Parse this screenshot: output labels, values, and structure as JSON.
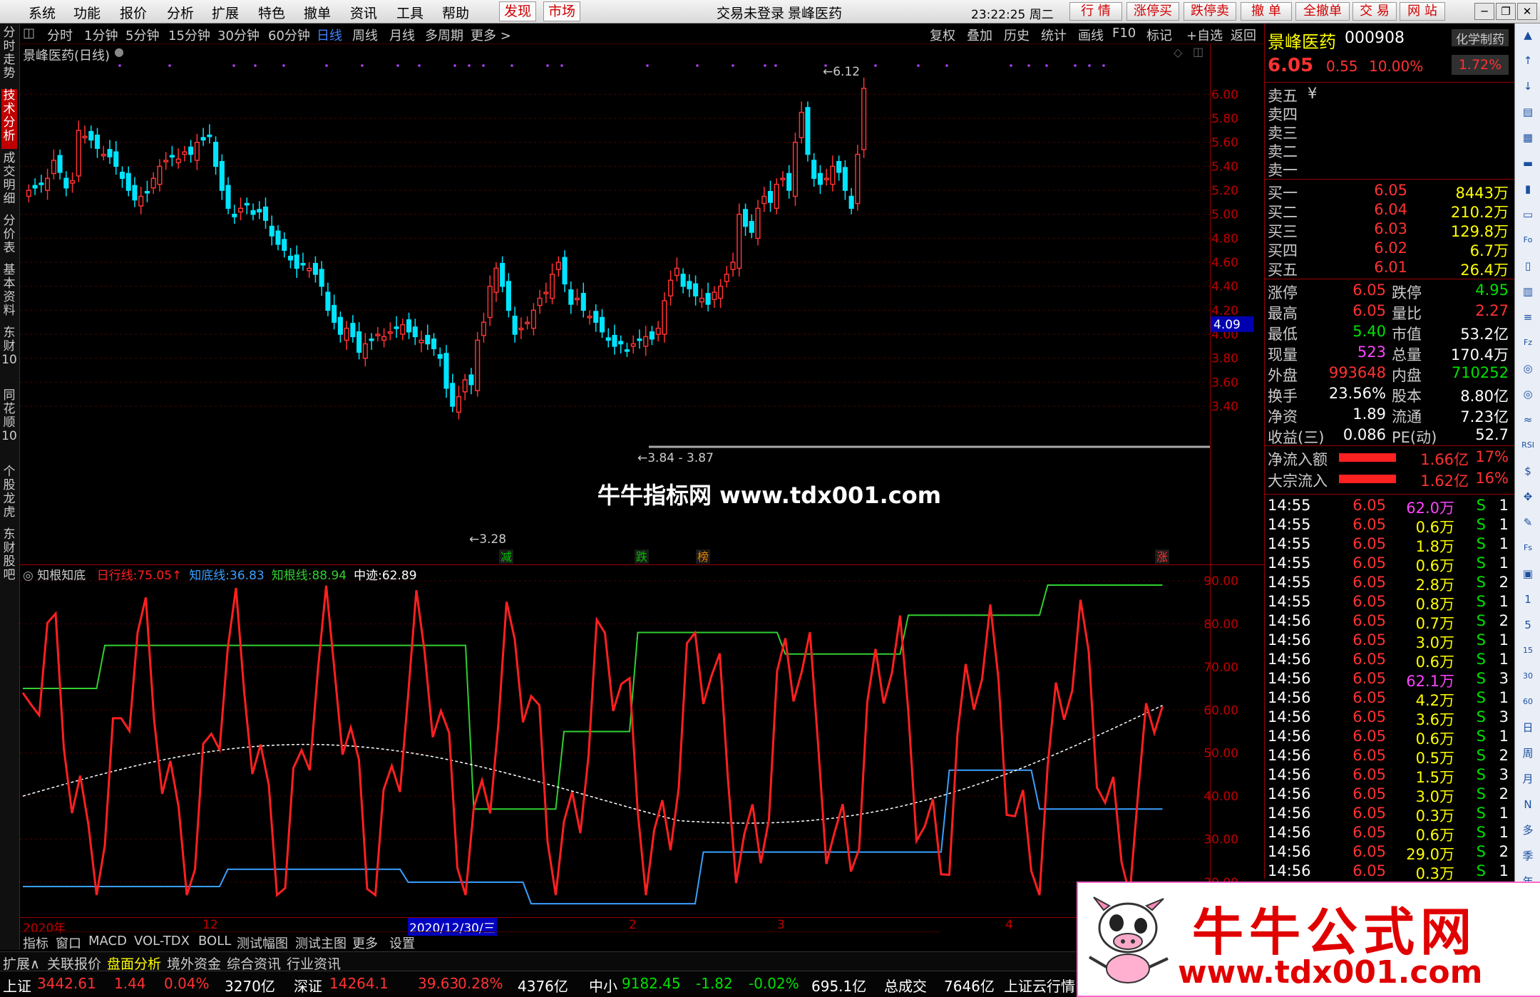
{
  "menu": {
    "items": [
      "系统",
      "功能",
      "报价",
      "分析",
      "扩展",
      "特色",
      "撤单",
      "资讯",
      "工具",
      "帮助"
    ],
    "hot": [
      "发现",
      "市场"
    ],
    "login_status": "交易未登录",
    "stock_title": "景峰医药",
    "clock": "23:22:25 周二",
    "trade_buttons": [
      "行 情",
      "涨停买",
      "跌停卖",
      "撤 单",
      "全撤单",
      "交 易",
      "网 站"
    ],
    "window_buttons": [
      "─",
      "❐",
      "✕"
    ]
  },
  "periods": [
    "分时",
    "1分钟",
    "5分钟",
    "15分钟",
    "30分钟",
    "60分钟",
    "日线",
    "周线",
    "月线",
    "多周期",
    "更多 >"
  ],
  "active_period": "日线",
  "tools": [
    "复权",
    "叠加",
    "历史",
    "统计",
    "画线",
    "F10",
    "标记",
    "+自选",
    "返回"
  ],
  "left_tabs": [
    "分时走势",
    "技术分析",
    "成交明细",
    "分价表",
    "基本资料",
    "东财10",
    "同花顺10",
    "个股龙虎",
    "东财股吧"
  ],
  "main_chart": {
    "label": "景峰医药(日线)",
    "price_ticks": [
      "6.00",
      "5.80",
      "5.60",
      "5.40",
      "5.20",
      "5.00",
      "4.80",
      "4.60",
      "4.40",
      "4.20",
      "4.00",
      "3.80",
      "3.60",
      "3.40"
    ],
    "current_price_tag": "4.09",
    "high_marker": "6.12",
    "low_marker": "3.28",
    "range_marker": "3.84 - 3.87",
    "event_labels": [
      {
        "text": "减",
        "color": "#00c000"
      },
      {
        "text": "跌",
        "color": "#00c000"
      },
      {
        "text": "榜",
        "color": "#e08000"
      },
      {
        "text": "涨",
        "color": "#ff3030"
      }
    ],
    "watermark": "牛牛指标网 www.tdx001.com"
  },
  "indicator": {
    "name": "知根知底",
    "lines": [
      {
        "label": "日行线:",
        "value": "75.05↑",
        "color": "#ff2020"
      },
      {
        "label": "知底线:",
        "value": "36.83",
        "color": "#3aa0ff"
      },
      {
        "label": "知根线:",
        "value": "88.94",
        "color": "#30d030"
      },
      {
        "label": "中迹:",
        "value": "62.89",
        "color": "#ffffff"
      }
    ],
    "ticks": [
      "90.00",
      "80.00",
      "70.00",
      "60.00",
      "50.00",
      "40.00",
      "30.00",
      "20.00"
    ]
  },
  "time_axis": {
    "labels": [
      "2020年",
      "12",
      "2020/12/30/三",
      "2",
      "3",
      "4"
    ]
  },
  "bottom_tabs": [
    "指标",
    "窗口",
    "MACD",
    "VOL-TDX",
    "BOLL",
    "测试幅图",
    "测试主图",
    "更多",
    "设置"
  ],
  "ext_tabs": [
    "扩展∧",
    "关联报价",
    "盘面分析",
    "境外资金",
    "综合资讯",
    "行业资讯"
  ],
  "status_bar": {
    "sh_label": "上证",
    "sh_index": "3442.61",
    "sh_change": "1.44",
    "sh_pct": "0.04%",
    "sh_amount": "3270亿",
    "sz_label": "深证",
    "sz_index": "14264.1",
    "sz_change": "39.63",
    "sz_pct": "0.28%",
    "sz_amount": "4376亿",
    "zx_label": "中小",
    "zx_index": "9182.45",
    "zx_change": "-1.82",
    "zx_pct": "-0.02%",
    "zx_amount": "695.1亿",
    "total_label": "总成交",
    "total_amount": "7646亿",
    "cloud": "上证云行情"
  },
  "quote": {
    "name": "景峰医药",
    "code": "000908",
    "industry": "化学制药",
    "price": "6.05",
    "change": "0.55",
    "pct": "10.00%",
    "sector_pct": "1.72%",
    "sell": [
      {
        "label": "卖五",
        "extra": "¥"
      },
      {
        "label": "卖四",
        "extra": ""
      },
      {
        "label": "卖三",
        "extra": ""
      },
      {
        "label": "卖二",
        "extra": ""
      },
      {
        "label": "卖一",
        "extra": ""
      }
    ],
    "buy": [
      {
        "label": "买一",
        "price": "6.05",
        "vol": "8443万"
      },
      {
        "label": "买二",
        "price": "6.04",
        "vol": "210.2万"
      },
      {
        "label": "买三",
        "price": "6.03",
        "vol": "129.8万"
      },
      {
        "label": "买四",
        "price": "6.02",
        "vol": "6.7万"
      },
      {
        "label": "买五",
        "price": "6.01",
        "vol": "26.4万"
      }
    ],
    "stats": [
      {
        "l1": "涨停",
        "v1": "6.05",
        "c1": "red",
        "l2": "跌停",
        "v2": "4.95",
        "c2": "green"
      },
      {
        "l1": "最高",
        "v1": "6.05",
        "c1": "red",
        "l2": "量比",
        "v2": "2.27",
        "c2": "red"
      },
      {
        "l1": "最低",
        "v1": "5.40",
        "c1": "green",
        "l2": "市值",
        "v2": "53.2亿",
        "c2": "white"
      },
      {
        "l1": "现量",
        "v1": "523",
        "c1": "magenta",
        "l2": "总量",
        "v2": "170.4万",
        "c2": "white"
      },
      {
        "l1": "外盘",
        "v1": "993648",
        "c1": "red",
        "l2": "内盘",
        "v2": "710252",
        "c2": "green"
      },
      {
        "l1": "换手",
        "v1": "23.56%",
        "c1": "white",
        "l2": "股本",
        "v2": "8.80亿",
        "c2": "white"
      },
      {
        "l1": "净资",
        "v1": "1.89",
        "c1": "white",
        "l2": "流通",
        "v2": "7.23亿",
        "c2": "white"
      },
      {
        "l1": "收益(三)",
        "v1": "0.086",
        "c1": "white",
        "l2": "PE(动)",
        "v2": "52.7",
        "c2": "white"
      }
    ],
    "flows": [
      {
        "label": "净流入额",
        "value": "1.66亿",
        "pct": "17%"
      },
      {
        "label": "大宗流入",
        "value": "1.62亿",
        "pct": "16%"
      }
    ],
    "ticks": [
      {
        "t": "14:55",
        "p": "6.05",
        "v": "62.0万",
        "mag": true,
        "n": "1"
      },
      {
        "t": "14:55",
        "p": "6.05",
        "v": "0.6万",
        "mag": false,
        "n": "1"
      },
      {
        "t": "14:55",
        "p": "6.05",
        "v": "1.8万",
        "mag": false,
        "n": "1"
      },
      {
        "t": "14:55",
        "p": "6.05",
        "v": "0.6万",
        "mag": false,
        "n": "1"
      },
      {
        "t": "14:55",
        "p": "6.05",
        "v": "2.8万",
        "mag": false,
        "n": "2"
      },
      {
        "t": "14:55",
        "p": "6.05",
        "v": "0.8万",
        "mag": false,
        "n": "1"
      },
      {
        "t": "14:56",
        "p": "6.05",
        "v": "0.7万",
        "mag": false,
        "n": "2"
      },
      {
        "t": "14:56",
        "p": "6.05",
        "v": "3.0万",
        "mag": false,
        "n": "1"
      },
      {
        "t": "14:56",
        "p": "6.05",
        "v": "0.6万",
        "mag": false,
        "n": "1"
      },
      {
        "t": "14:56",
        "p": "6.05",
        "v": "62.1万",
        "mag": true,
        "n": "3"
      },
      {
        "t": "14:56",
        "p": "6.05",
        "v": "4.2万",
        "mag": false,
        "n": "1"
      },
      {
        "t": "14:56",
        "p": "6.05",
        "v": "3.6万",
        "mag": false,
        "n": "3"
      },
      {
        "t": "14:56",
        "p": "6.05",
        "v": "0.6万",
        "mag": false,
        "n": "1"
      },
      {
        "t": "14:56",
        "p": "6.05",
        "v": "0.5万",
        "mag": false,
        "n": "2"
      },
      {
        "t": "14:56",
        "p": "6.05",
        "v": "1.5万",
        "mag": false,
        "n": "3"
      },
      {
        "t": "14:56",
        "p": "6.05",
        "v": "3.0万",
        "mag": false,
        "n": "2"
      },
      {
        "t": "14:56",
        "p": "6.05",
        "v": "0.3万",
        "mag": false,
        "n": "1"
      },
      {
        "t": "14:56",
        "p": "6.05",
        "v": "0.6万",
        "mag": false,
        "n": "1"
      },
      {
        "t": "14:56",
        "p": "6.05",
        "v": "29.0万",
        "mag": false,
        "n": "2"
      },
      {
        "t": "14:56",
        "p": "6.05",
        "v": "0.3万",
        "mag": false,
        "n": "1"
      }
    ],
    "side": "S"
  },
  "right_strip": [
    "▲",
    "↑",
    "↓",
    "▤",
    "▦",
    "▬",
    "▮",
    "▭",
    "Fo",
    "▯",
    "▥",
    "≡",
    "Fz",
    "◎",
    "◎",
    "≈",
    "RSI",
    "$",
    "✥",
    "✎",
    "Fs",
    "▣",
    "1",
    "5",
    "15",
    "30",
    "60",
    "日",
    "周",
    "月",
    "N",
    "多",
    "季",
    "年"
  ],
  "ad": {
    "title": "牛牛公式网",
    "url": "www.tdx001.com"
  },
  "colors": {
    "up": "#ff3232",
    "down": "#00ffff",
    "bg": "#000000",
    "grid": "#5a0000"
  }
}
